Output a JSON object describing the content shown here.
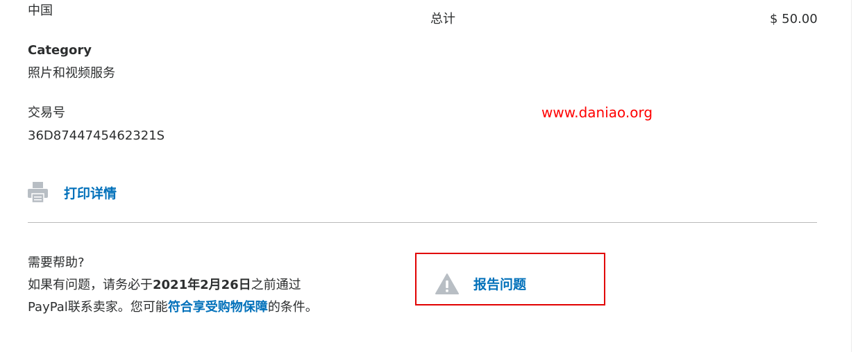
{
  "details": {
    "country": "中国",
    "category_label": "Category",
    "category_value": "照片和视频服务",
    "txn_label": "交易号",
    "txn_value": "36D8744745462321S"
  },
  "summary": {
    "total_label": "总计",
    "total_value": "$ 50.00"
  },
  "watermark": "www.daniao.org",
  "print": {
    "icon": "printer-icon",
    "label": "打印详情"
  },
  "help": {
    "title": "需要帮助?",
    "line1_prefix": "如果有问题，请务必于",
    "line1_date": "2021年2月26日",
    "line1_suffix": "之前通过",
    "line2_prefix": "PayPal联系卖家。您可能",
    "line2_link": "符合享受购物保障",
    "line2_suffix": "的条件。"
  },
  "report": {
    "icon": "warning-icon",
    "label": "报告问题"
  },
  "colors": {
    "link": "#0070ba",
    "highlight_border": "#e10000",
    "watermark": "#ff0000",
    "icon_gray": "#b8bec4"
  }
}
